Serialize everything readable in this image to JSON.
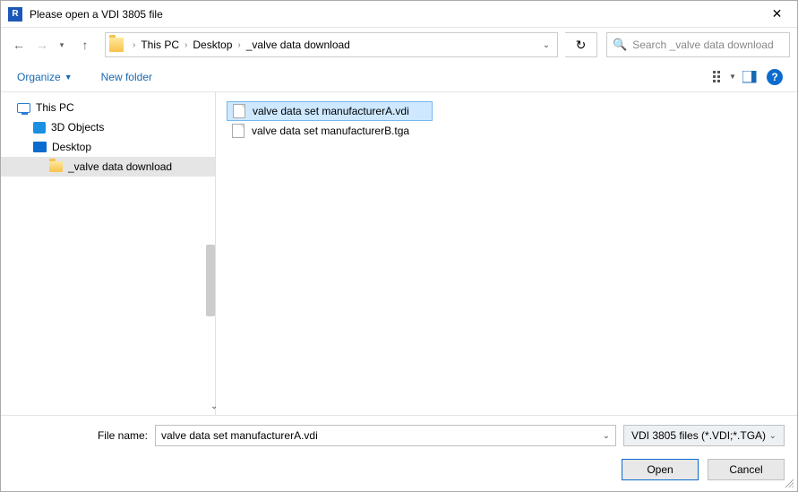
{
  "window": {
    "title": "Please open a VDI 3805 file",
    "app_icon_letter": "R"
  },
  "nav": {
    "breadcrumb": [
      "This PC",
      "Desktop",
      "_valve data download"
    ]
  },
  "search": {
    "placeholder": "Search _valve data download"
  },
  "toolbar": {
    "organize": "Organize",
    "new_folder": "New folder"
  },
  "tree": {
    "items": [
      {
        "label": "This PC",
        "icon": "pc",
        "depth": 0
      },
      {
        "label": "3D Objects",
        "icon": "3d",
        "depth": 1
      },
      {
        "label": "Desktop",
        "icon": "desktop",
        "depth": 1
      },
      {
        "label": "_valve data download",
        "icon": "folder",
        "depth": 2,
        "selected": true
      }
    ]
  },
  "files": [
    {
      "name": "valve data set manufacturerA.vdi",
      "selected": true
    },
    {
      "name": "valve data set manufacturerB.tga",
      "selected": false
    }
  ],
  "footer": {
    "filename_label": "File name:",
    "filename_value": "valve data set manufacturerA.vdi",
    "filter": "VDI 3805 files (*.VDI;*.TGA)",
    "open": "Open",
    "cancel": "Cancel"
  }
}
